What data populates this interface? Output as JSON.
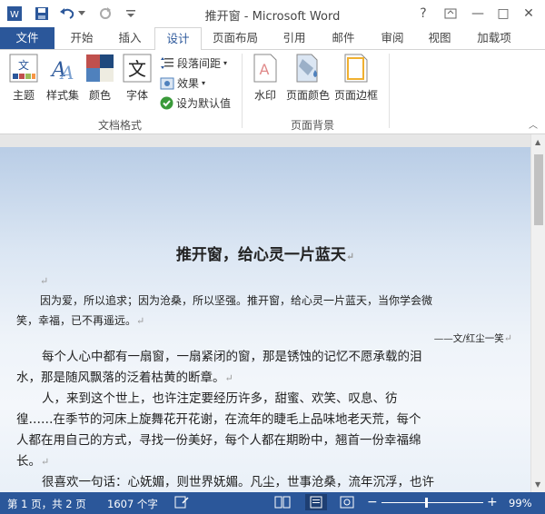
{
  "window": {
    "title": "推开窗 - Microsoft Word"
  },
  "quick_access": {
    "word_logo": "W"
  },
  "window_controls": {
    "help": "?",
    "minimize": "—",
    "restore": "□",
    "close": "✕"
  },
  "tabs": [
    {
      "label": "文件"
    },
    {
      "label": "开始"
    },
    {
      "label": "插入"
    },
    {
      "label": "设计"
    },
    {
      "label": "页面布局"
    },
    {
      "label": "引用"
    },
    {
      "label": "邮件"
    },
    {
      "label": "审阅"
    },
    {
      "label": "视图"
    },
    {
      "label": "加载项"
    }
  ],
  "ribbon": {
    "doc_format": {
      "theme": "主题",
      "style_set": "样式集",
      "colors": "颜色",
      "fonts": "字体",
      "paragraph_spacing": "段落间距",
      "effects": "效果",
      "set_default": "设为默认值",
      "group_label": "文档格式"
    },
    "page_background": {
      "watermark": "水印",
      "page_color": "页面颜色",
      "page_border": "页面边框",
      "group_label": "页面背景"
    }
  },
  "document": {
    "title": "推开窗，给心灵一片蓝天",
    "intro_line1": "因为爱，所以追求；因为沧桑，所以坚强。推开窗，给心灵一片蓝天，当你学会微",
    "intro_line2": "笑，幸福，已不再遥远。",
    "byline": "——文/红尘一笑",
    "p1_line1": "每个人心中都有一扇窗，一扇紧闭的窗，那是锈蚀的记忆不愿承载的泪",
    "p1_line2": "水，那是随风飘落的泛着枯黄的断章。",
    "p2_line1": "人，来到这个世上，也许注定要经历许多，甜蜜、欢笑、叹息、彷",
    "p2_line2": "徨……在季节的河床上旋舞花开花谢，在流年的睫毛上品味地老天荒，每个",
    "p2_line3": "人都在用自己的方式，寻找一份美好，每个人都在期盼中，翘首一份幸福绵",
    "p2_line4": "长。",
    "p3_line1": "很喜欢一句话：心妩媚，则世界妩媚。凡尘，世事沧桑，流年沉浮，也许"
  },
  "status": {
    "page": "第 1 页，共 2 页",
    "words": "1607 个字",
    "zoom": "99%",
    "zoom_minus": "−",
    "zoom_plus": "+"
  },
  "colors": {
    "accent": "#2b579a"
  }
}
